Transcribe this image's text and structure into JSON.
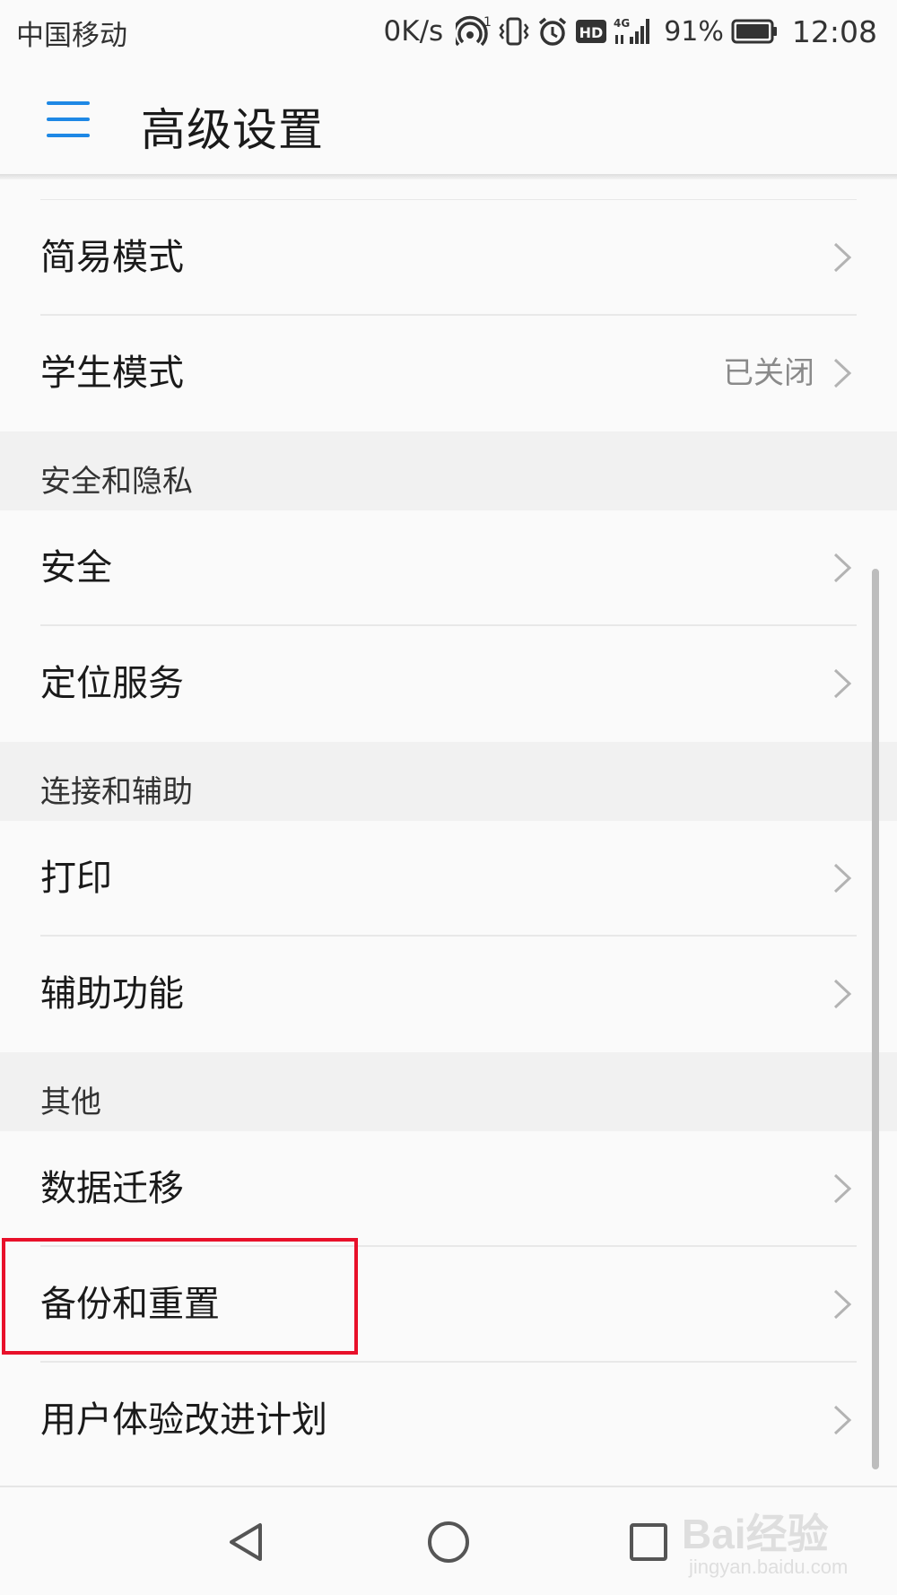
{
  "status_bar": {
    "carrier": "中国移动",
    "speed": "0K/s",
    "hotspot_count": "1",
    "hd": "HD",
    "network": "4G",
    "battery": "91%",
    "time": "12:08"
  },
  "toolbar": {
    "title": "高级设置"
  },
  "rows": {
    "simple_mode": {
      "label": "简易模式"
    },
    "student_mode": {
      "label": "学生模式",
      "value": "已关闭"
    },
    "security": {
      "label": "安全"
    },
    "location": {
      "label": "定位服务"
    },
    "print": {
      "label": "打印"
    },
    "accessibility": {
      "label": "辅助功能"
    },
    "data_migration": {
      "label": "数据迁移"
    },
    "backup_reset": {
      "label": "备份和重置"
    },
    "ux_program": {
      "label": "用户体验改进计划"
    }
  },
  "sections": {
    "security_privacy": "安全和隐私",
    "connection_assist": "连接和辅助",
    "other": "其他"
  },
  "watermark": {
    "brand": "Bai经验",
    "url": "jingyan.baidu.com"
  },
  "colors": {
    "accent": "#1e88e5",
    "highlight": "#e8102a",
    "section_bg": "#f1f1f1",
    "secondary_text": "#8a8a8a"
  },
  "icons": [
    "menu-icon",
    "hotspot-icon",
    "vibrate-icon",
    "alarm-icon",
    "signal-icon",
    "battery-icon",
    "chevron-right-icon",
    "back-icon",
    "home-icon",
    "recents-icon"
  ]
}
